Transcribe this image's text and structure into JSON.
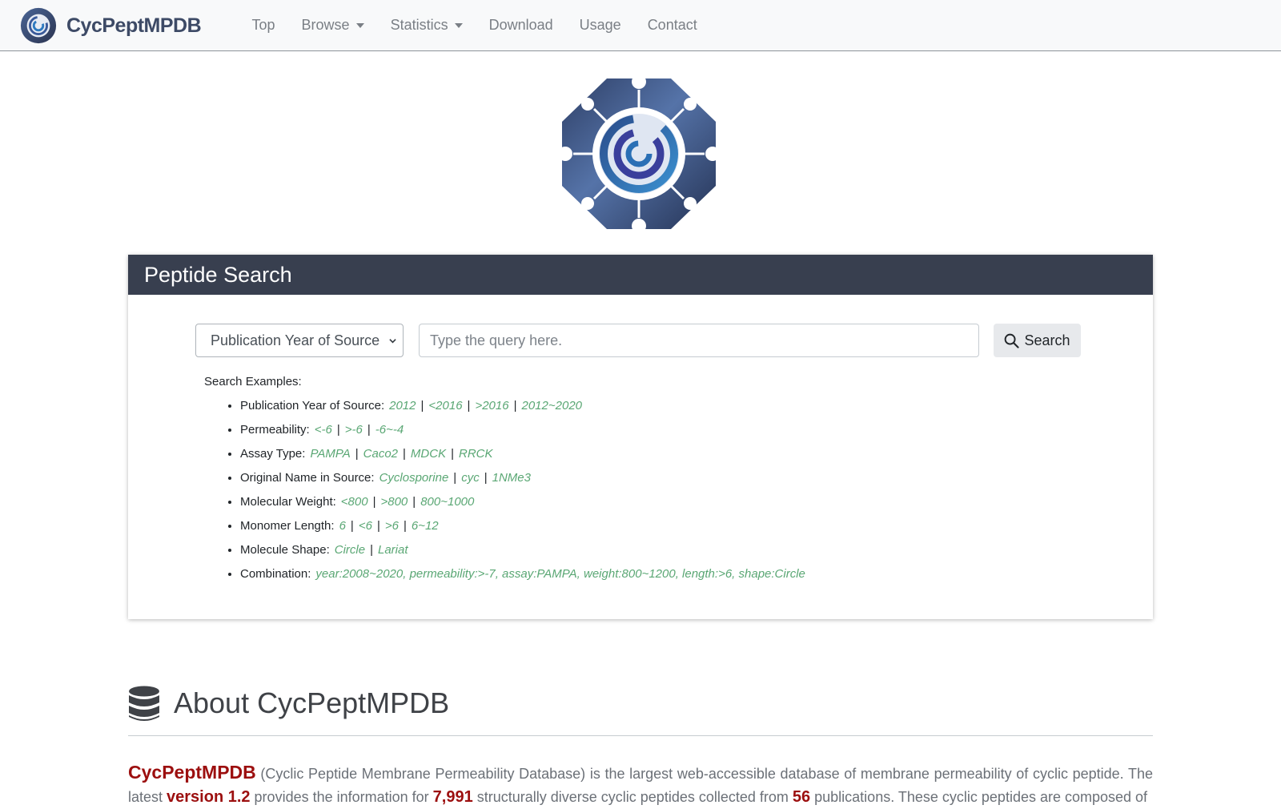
{
  "navbar": {
    "brand": "CycPeptMPDB",
    "items": [
      {
        "label": "Top",
        "dropdown": false
      },
      {
        "label": "Browse",
        "dropdown": true
      },
      {
        "label": "Statistics",
        "dropdown": true
      },
      {
        "label": "Download",
        "dropdown": false
      },
      {
        "label": "Usage",
        "dropdown": false
      },
      {
        "label": "Contact",
        "dropdown": false
      }
    ]
  },
  "search": {
    "title": "Peptide Search",
    "field_selected": "Publication Year of Source",
    "placeholder": "Type the query here.",
    "button_label": "Search",
    "examples_title": "Search Examples:",
    "examples": [
      {
        "label": "Publication Year of Source:",
        "values": [
          "2012",
          "<2016",
          ">2016",
          "2012~2020"
        ]
      },
      {
        "label": "Permeability:",
        "values": [
          "<-6",
          ">-6",
          "-6~-4"
        ]
      },
      {
        "label": "Assay Type:",
        "values": [
          "PAMPA",
          "Caco2",
          "MDCK",
          "RRCK"
        ]
      },
      {
        "label": "Original Name in Source:",
        "values": [
          "Cyclosporine",
          "cyc",
          "1NMe3"
        ]
      },
      {
        "label": "Molecular Weight:",
        "values": [
          "<800",
          ">800",
          "800~1000"
        ]
      },
      {
        "label": "Monomer Length:",
        "values": [
          "6",
          "<6",
          ">6",
          "6~12"
        ]
      },
      {
        "label": "Molecule Shape:",
        "values": [
          "Circle",
          "Lariat"
        ]
      },
      {
        "label": "Combination:",
        "values": [
          "year:2008~2020, permeability:>-7, assay:PAMPA, weight:800~1200, length:>6, shape:Circle"
        ]
      }
    ]
  },
  "about": {
    "title": "About CycPeptMPDB",
    "name": "CycPeptMPDB",
    "text1": " (Cyclic Peptide Membrane Permeability Database) is the largest web-accessible database of membrane permeability of cyclic peptide. The latest ",
    "version": "version 1.2",
    "text2": " provides the information for ",
    "count": "7,991",
    "text3": " structurally diverse cyclic peptides collected from ",
    "publications": "56",
    "text4": " publications. These cyclic peptides are composed of"
  },
  "colors": {
    "navbar_bg": "#f8f9fa",
    "card_header_bg": "#383f4f",
    "example_link": "#5aa774",
    "accent_red": "#9c0f0f"
  }
}
